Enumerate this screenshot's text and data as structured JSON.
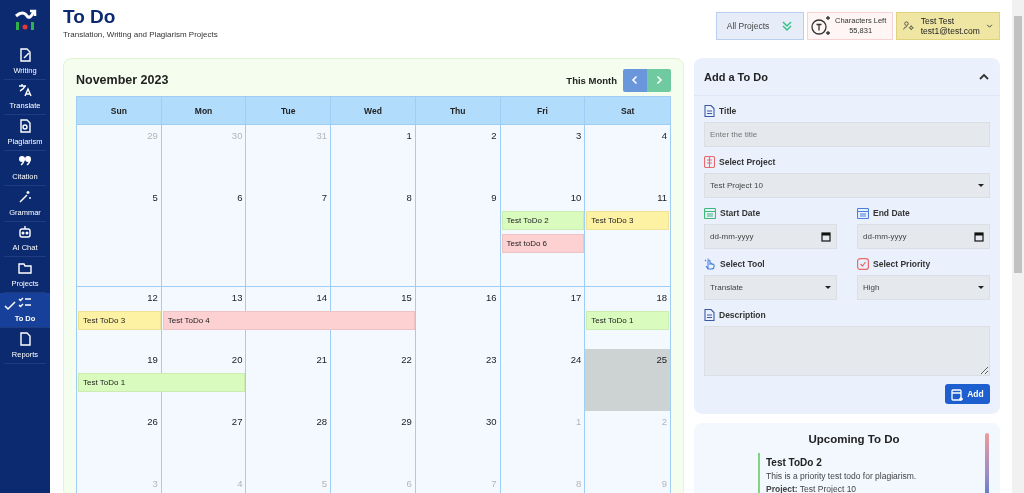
{
  "sidebar": {
    "items": [
      {
        "label": "Writing",
        "selected": false
      },
      {
        "label": "Translate",
        "selected": false
      },
      {
        "label": "Plagiarism",
        "selected": false
      },
      {
        "label": "Citation",
        "selected": false
      },
      {
        "label": "Grammar",
        "selected": false
      },
      {
        "label": "AI Chat",
        "selected": false
      },
      {
        "label": "Projects",
        "selected": false
      },
      {
        "label": "To Do",
        "selected": true
      },
      {
        "label": "Reports",
        "selected": false
      }
    ]
  },
  "header": {
    "title": "To Do",
    "subtitle": "Translation, Writing and Plagiarism Projects",
    "project_filter": "All Projects",
    "credits": {
      "label": "Characters Left",
      "value": "55,831"
    },
    "user": {
      "name": "Test Test",
      "email": "test1@test.com"
    }
  },
  "calendar": {
    "title": "November 2023",
    "today_button": "This Month",
    "weekdays": [
      "Sun",
      "Mon",
      "Tue",
      "Wed",
      "Thu",
      "Fri",
      "Sat"
    ],
    "weeks": [
      {
        "days": [
          {
            "n": "29",
            "muted": true,
            "today": false
          },
          {
            "n": "30",
            "muted": true,
            "today": false
          },
          {
            "n": "31",
            "muted": true,
            "today": false
          },
          {
            "n": "1",
            "muted": false,
            "today": false
          },
          {
            "n": "2",
            "muted": false,
            "today": false
          },
          {
            "n": "3",
            "muted": false,
            "today": false
          },
          {
            "n": "4",
            "muted": false,
            "today": false
          }
        ]
      },
      {
        "days": [
          {
            "n": "5",
            "muted": false,
            "today": false
          },
          {
            "n": "6",
            "muted": false,
            "today": false
          },
          {
            "n": "7",
            "muted": false,
            "today": false
          },
          {
            "n": "8",
            "muted": false,
            "today": false
          },
          {
            "n": "9",
            "muted": false,
            "today": false
          },
          {
            "n": "10",
            "muted": false,
            "today": false,
            "events": [
              {
                "kind": "event",
                "title": "Test ToDo 2",
                "color": "#d9fbbe"
              },
              {
                "kind": "event",
                "title": "Test toDo 6",
                "color": "#fdd0d2"
              }
            ]
          },
          {
            "n": "11",
            "muted": false,
            "today": false,
            "events": [
              {
                "kind": "event",
                "title": "Test ToDo 3",
                "color": "#fdf1a3"
              }
            ]
          }
        ]
      },
      {
        "days": [
          {
            "n": "12",
            "muted": false,
            "today": false,
            "events": [
              {
                "kind": "event",
                "title": "Test ToDo 3",
                "color": "#fdf1a3"
              }
            ]
          },
          {
            "n": "13",
            "muted": false,
            "today": false,
            "events": [
              {
                "kind": "event",
                "title": "Test ToDo 4",
                "color": "#fdd0d2",
                "continues": true
              }
            ]
          },
          {
            "n": "14",
            "muted": false,
            "today": false,
            "events": [
              {
                "kind": "continued",
                "continues": true
              }
            ]
          },
          {
            "n": "15",
            "muted": false,
            "today": false,
            "events": [
              {
                "kind": "continued",
                "continues": false
              }
            ]
          },
          {
            "n": "16",
            "muted": false,
            "today": false
          },
          {
            "n": "17",
            "muted": false,
            "today": false
          },
          {
            "n": "18",
            "muted": false,
            "today": false,
            "events": [
              {
                "kind": "event",
                "title": "Test ToDo 1",
                "color": "#d9fbbe"
              }
            ]
          }
        ]
      },
      {
        "days": [
          {
            "n": "19",
            "muted": false,
            "today": false,
            "events": [
              {
                "kind": "event",
                "title": "Test ToDo 1",
                "color": "#d9fbbe",
                "continues": true
              }
            ]
          },
          {
            "n": "20",
            "muted": false,
            "today": false,
            "events": [
              {
                "kind": "continued",
                "continues": false
              }
            ]
          },
          {
            "n": "21",
            "muted": false,
            "today": false
          },
          {
            "n": "22",
            "muted": false,
            "today": false
          },
          {
            "n": "23",
            "muted": false,
            "today": false
          },
          {
            "n": "24",
            "muted": false,
            "today": false
          },
          {
            "n": "25",
            "muted": false,
            "today": true
          }
        ]
      },
      {
        "days": [
          {
            "n": "26",
            "muted": false,
            "today": false
          },
          {
            "n": "27",
            "muted": false,
            "today": false
          },
          {
            "n": "28",
            "muted": false,
            "today": false
          },
          {
            "n": "29",
            "muted": false,
            "today": false
          },
          {
            "n": "30",
            "muted": false,
            "today": false
          },
          {
            "n": "1",
            "muted": true,
            "today": false
          },
          {
            "n": "2",
            "muted": true,
            "today": false
          }
        ]
      },
      {
        "days": [
          {
            "n": "3",
            "muted": true,
            "today": false
          },
          {
            "n": "4",
            "muted": true,
            "today": false
          },
          {
            "n": "5",
            "muted": true,
            "today": false
          },
          {
            "n": "6",
            "muted": true,
            "today": false
          },
          {
            "n": "7",
            "muted": true,
            "today": false
          },
          {
            "n": "8",
            "muted": true,
            "today": false
          },
          {
            "n": "9",
            "muted": true,
            "today": false
          }
        ]
      }
    ]
  },
  "add_todo": {
    "title": "Add a To Do",
    "expanded": true,
    "title_field": {
      "label": "Title",
      "placeholder": "Enter the title"
    },
    "project_field": {
      "label": "Select Project",
      "value": "Test Project 10"
    },
    "start_date": {
      "label": "Start Date",
      "placeholder": "dd-mm-yyyy"
    },
    "end_date": {
      "label": "End Date",
      "placeholder": "dd-mm-yyyy"
    },
    "tool_field": {
      "label": "Select Tool",
      "value": "Translate"
    },
    "priority_field": {
      "label": "Select Priority",
      "value": "High"
    },
    "description": {
      "label": "Description"
    },
    "add_button": "Add"
  },
  "upcoming": {
    "title": "Upcoming To Do",
    "items": [
      {
        "title": "Test ToDo 2",
        "description": "This is a priority test todo for plagiarism.",
        "project": "**Project:** Test Project 10",
        "color": "#7ed67e"
      }
    ]
  }
}
